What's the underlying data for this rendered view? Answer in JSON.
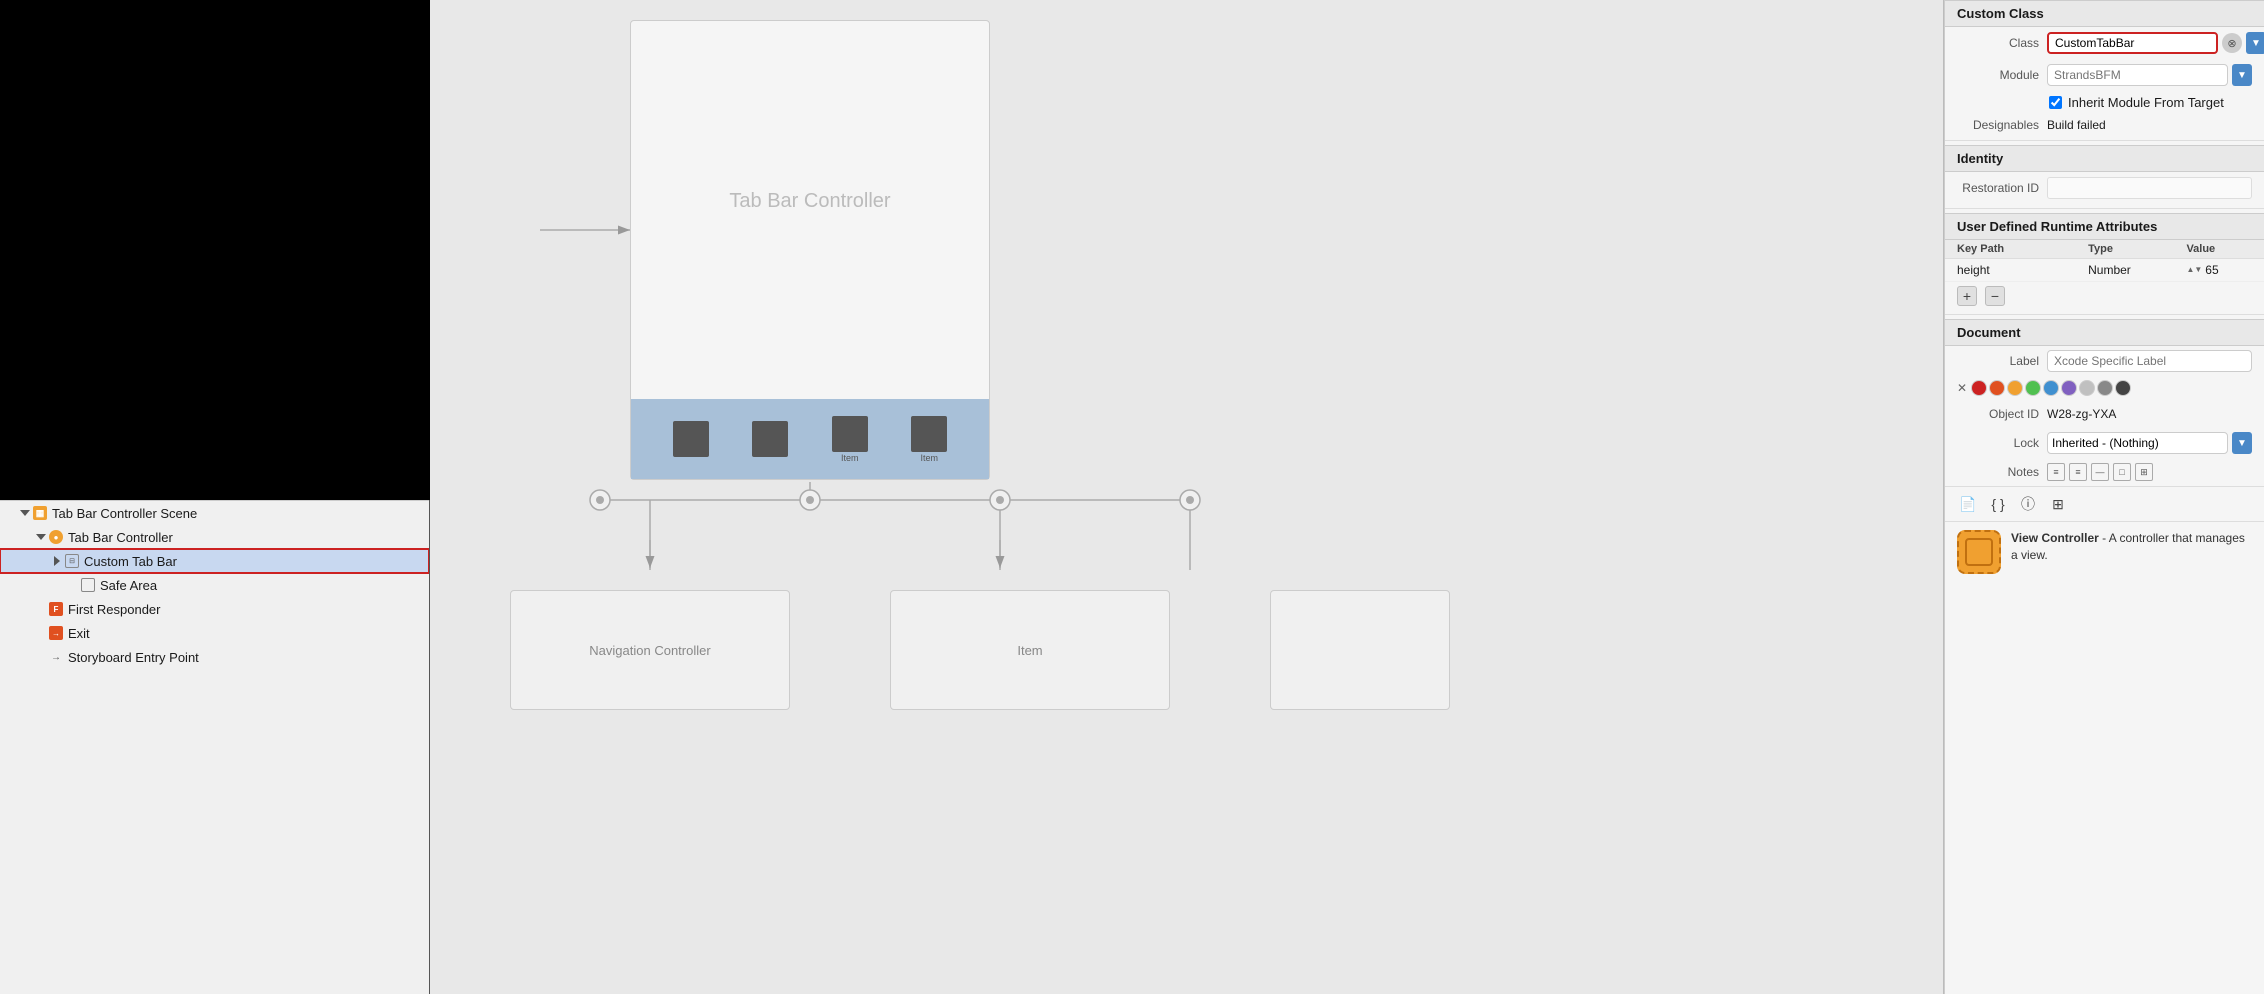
{
  "leftPanel": {
    "previewBg": "#000000",
    "navigator": {
      "items": [
        {
          "id": "scene",
          "label": "Tab Bar Controller Scene",
          "indent": 0,
          "triangle": "open",
          "iconType": "scene"
        },
        {
          "id": "tbc",
          "label": "Tab Bar Controller",
          "indent": 1,
          "triangle": "open",
          "iconType": "tab-bar-ctrl"
        },
        {
          "id": "custom-tab-bar",
          "label": "Custom Tab Bar",
          "indent": 2,
          "triangle": "closed",
          "iconType": "custom-tab",
          "selected": true
        },
        {
          "id": "safe-area",
          "label": "Safe Area",
          "indent": 3,
          "triangle": "none",
          "iconType": "safe-area"
        },
        {
          "id": "first-responder",
          "label": "First Responder",
          "indent": 1,
          "triangle": "none",
          "iconType": "first-responder"
        },
        {
          "id": "exit",
          "label": "Exit",
          "indent": 1,
          "triangle": "none",
          "iconType": "exit"
        },
        {
          "id": "entry-point",
          "label": "Storyboard Entry Point",
          "indent": 1,
          "triangle": "none",
          "iconType": "entry-point"
        }
      ]
    }
  },
  "canvas": {
    "tbcLabel": "Tab Bar Controller",
    "tabItems": [
      "",
      "",
      "",
      ""
    ],
    "tabItemLabels": [
      "",
      "",
      "Item",
      "Item"
    ],
    "navControllerLabel": "Navigation Controller",
    "itemLabel": "Item"
  },
  "rightPanel": {
    "sections": {
      "customClass": {
        "header": "Custom Class",
        "classLabel": "Class",
        "classValue": "CustomTabBar",
        "moduleLabel": "Module",
        "moduleValue": "StrandsBFM",
        "moduleArrow": "▼",
        "inheritCheckbox": true,
        "inheritLabel": "Inherit Module From Target",
        "designablesLabel": "Designables",
        "designablesValue": "Build failed"
      },
      "identity": {
        "header": "Identity",
        "restorationIdLabel": "Restoration ID",
        "restorationIdValue": ""
      },
      "userDefinedRuntime": {
        "header": "User Defined Runtime Attributes",
        "columns": [
          "Key Path",
          "Type",
          "Value"
        ],
        "rows": [
          {
            "keyPath": "height",
            "type": "Number",
            "value": "65"
          }
        ]
      },
      "document": {
        "header": "Document",
        "labelLabel": "Label",
        "labelPlaceholder": "Xcode Specific Label",
        "colors": [
          "#cc2222",
          "#f03030",
          "#f0a030",
          "#50c050",
          "#4090d0",
          "#8060c0",
          "#b0b0b0",
          "#888888",
          "#444444"
        ],
        "objectIdLabel": "Object ID",
        "objectIdValue": "W28-zg-YXA",
        "lockLabel": "Lock",
        "lockValue": "Inherited - (Nothing)",
        "notesLabel": "Notes"
      }
    },
    "vcDescription": {
      "title": "View Controller",
      "desc": "- A controller that manages a view."
    },
    "toolbar": {
      "icons": [
        "doc",
        "braces",
        "circle-i",
        "lines"
      ]
    }
  }
}
